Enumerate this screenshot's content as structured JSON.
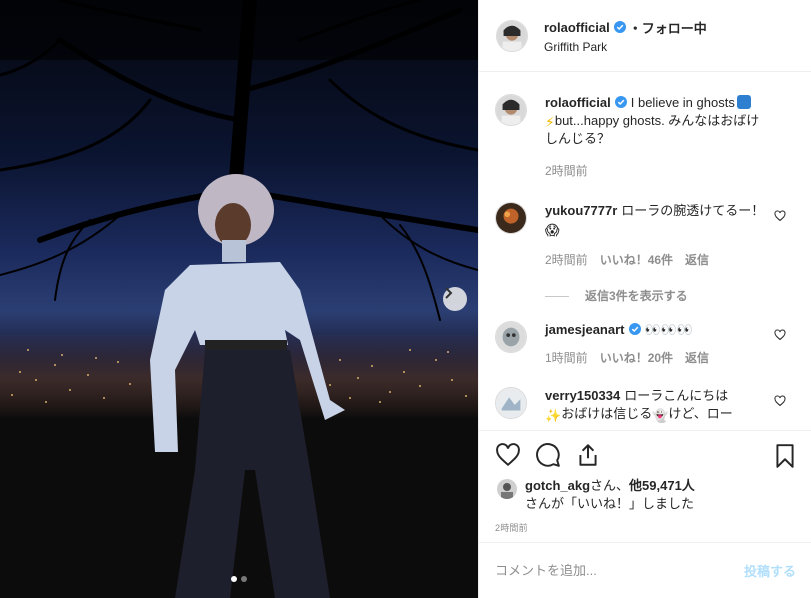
{
  "post": {
    "username": "rolaofficial",
    "follow_status": "・フォロー中",
    "location": "Griffith Park",
    "carousel": {
      "slides": 2,
      "current": 1
    }
  },
  "caption": {
    "username": "rolaofficial",
    "text_1": "I believe in ghosts",
    "text_2": "but...happy ghosts. みんなはおばけしんじる？",
    "time": "2時間前"
  },
  "comments": [
    {
      "username": "yukou7777r",
      "text": "ローラの腕透けてるー！",
      "time": "2時間前",
      "likes": "いいね！46件",
      "reply": "返信",
      "view_replies": "返信3件を表示する"
    },
    {
      "username": "jamesjeanart",
      "text": "",
      "time": "1時間前",
      "likes": "いいね！20件",
      "reply": "返信"
    },
    {
      "username": "verry150334",
      "text_1": "ローラこんにちは",
      "text_2": "おばけは信じる",
      "text_3": "けど、ロー"
    }
  ],
  "likes": {
    "user": "gotch_akg",
    "suffix_1": "さん、",
    "count": "他59,471人",
    "suffix_2": "さんが「いいね！」しました"
  },
  "post_time": "2時間前",
  "comment_box": {
    "placeholder": "コメントを追加...",
    "post_label": "投稿する"
  },
  "colors": {
    "accent": "#3897f0",
    "post_disabled": "#b2dffc",
    "muted": "#8e8e8e",
    "border": "#efefef"
  }
}
